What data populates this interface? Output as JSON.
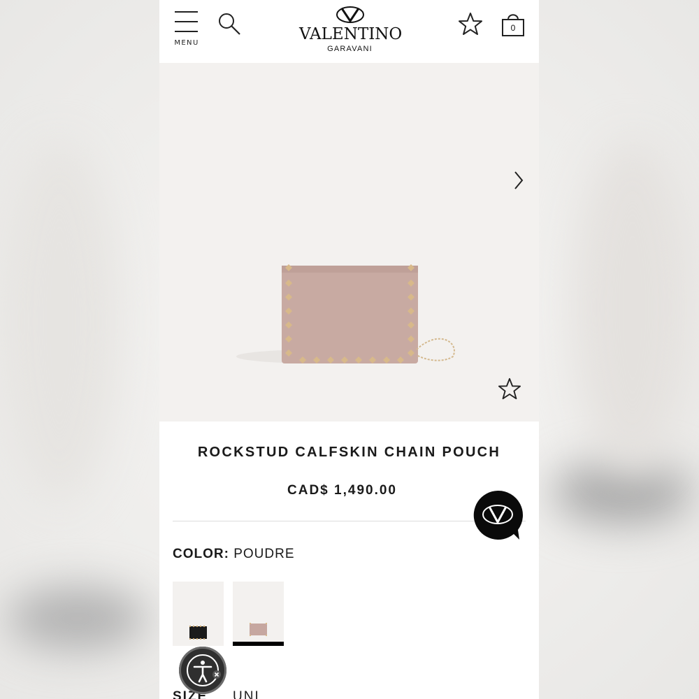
{
  "header": {
    "menu_label": "MENU",
    "logo_name": "VALENTINO",
    "logo_sub": "GARAVANI",
    "bag_count": "0",
    "icons": [
      "menu-icon",
      "search-icon",
      "star-icon",
      "shopping-bag-icon"
    ]
  },
  "gallery": {
    "icons": [
      "chevron-right-icon",
      "star-icon"
    ]
  },
  "product": {
    "title": "ROCKSTUD CALFSKIN CHAIN POUCH",
    "price": "CAD$ 1,490.00",
    "color_label": "COLOR:",
    "color_value": "POUDRE",
    "size_label": "SIZE",
    "size_value": "UNI",
    "swatches": [
      {
        "color": "#1b1b1b",
        "selected": false
      },
      {
        "color": "#c6a7a0",
        "selected": true
      }
    ]
  },
  "colors": {
    "accent": "#000000",
    "product_pink": "#c8aaa2",
    "stud_gold": "#d8b98a",
    "image_bg": "#f3f1ef"
  }
}
